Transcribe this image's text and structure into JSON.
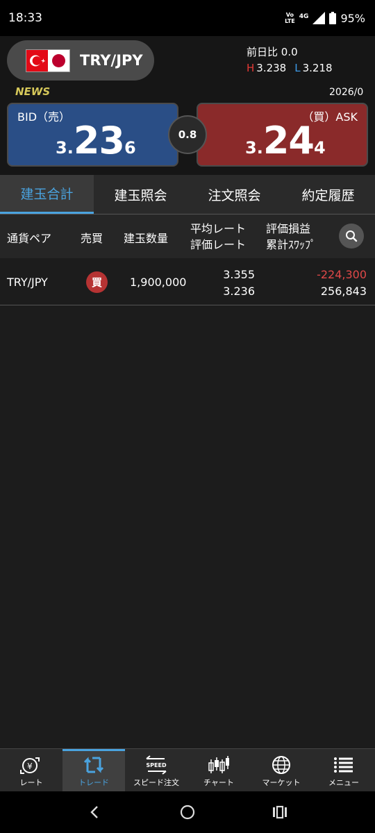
{
  "status_bar": {
    "time": "18:33",
    "volte": "Vo\nLTE",
    "network": "4G",
    "battery": "95%"
  },
  "header": {
    "pair": "TRY/JPY",
    "change_label": "前日比",
    "change_value": "0.0",
    "high_label": "H",
    "high_value": "3.238",
    "low_label": "L",
    "low_value": "3.218",
    "news_label": "NEWS",
    "date": "2026/0",
    "bid": {
      "label": "BID（売）",
      "prefix": "3.",
      "big": "23",
      "last": "6"
    },
    "ask": {
      "label": "（買）ASK",
      "prefix": "3.",
      "big": "24",
      "last": "4"
    },
    "spread": "0.8"
  },
  "tabs": [
    {
      "label": "建玉合計",
      "active": true
    },
    {
      "label": "建玉照会",
      "active": false
    },
    {
      "label": "注文照会",
      "active": false
    },
    {
      "label": "約定履歴",
      "active": false
    }
  ],
  "table": {
    "headers": {
      "pair": "通貨ペア",
      "side": "売買",
      "qty": "建玉数量",
      "rate1": "平均レート",
      "rate2": "評価レート",
      "pl1": "評価損益",
      "pl2": "累計ｽﾜｯﾌﾟ"
    },
    "rows": [
      {
        "pair": "TRY/JPY",
        "side": "買",
        "qty": "1,900,000",
        "avg_rate": "3.355",
        "eval_rate": "3.236",
        "pl": "-224,300",
        "swap": "256,843"
      }
    ]
  },
  "bottom_nav": [
    {
      "label": "レート",
      "icon": "rate-icon",
      "active": false
    },
    {
      "label": "トレード",
      "icon": "trade-icon",
      "active": true
    },
    {
      "label": "スピード注文",
      "icon": "speed-icon",
      "speed_text": "SPEED",
      "active": false
    },
    {
      "label": "チャート",
      "icon": "chart-icon",
      "active": false
    },
    {
      "label": "マーケット",
      "icon": "globe-icon",
      "active": false
    },
    {
      "label": "メニュー",
      "icon": "menu-icon",
      "active": false
    }
  ],
  "colors": {
    "bid": "#2a4e86",
    "ask": "#8a2a2a",
    "accent": "#4aa3df",
    "negative": "#e04848"
  }
}
